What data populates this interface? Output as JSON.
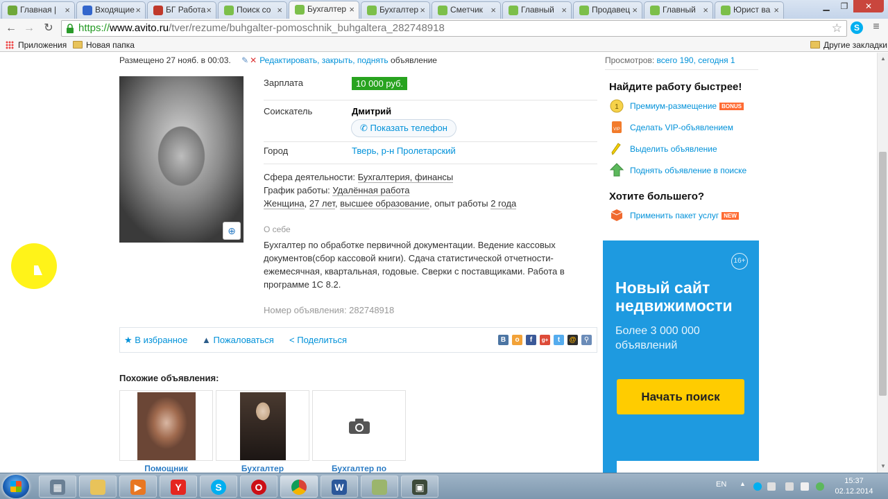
{
  "browser": {
    "tabs": [
      {
        "label": "Главная |",
        "color": "#6ea83a"
      },
      {
        "label": "Входящие",
        "color": "#3366cc"
      },
      {
        "label": "БГ Работа",
        "color": "#c0392b"
      },
      {
        "label": "Поиск со",
        "color": "#7cbf4a"
      },
      {
        "label": "Бухгалтер",
        "color": "#7cbf4a",
        "active": true
      },
      {
        "label": "Бухгалтер",
        "color": "#7cbf4a"
      },
      {
        "label": "Сметчик",
        "color": "#7cbf4a"
      },
      {
        "label": "Главный",
        "color": "#7cbf4a"
      },
      {
        "label": "Продавец",
        "color": "#7cbf4a"
      },
      {
        "label": "Главный",
        "color": "#7cbf4a"
      },
      {
        "label": "Юрист ва",
        "color": "#7cbf4a"
      }
    ],
    "url_scheme": "https://",
    "url_host": "www.avito.ru",
    "url_path": "/tver/rezume/buhgalter-pomoschnik_buhgaltera_282748918",
    "bookmarks": {
      "apps": "Приложения",
      "new_folder": "Новая папка",
      "other": "Другие закладки"
    }
  },
  "listing": {
    "posted": "Размещено 27 нояб. в 00:03.",
    "edit_link": "Редактировать, закрыть, поднять",
    "edit_suffix": "объявление",
    "salary_label": "Зарплата",
    "salary_value": "10 000 руб.",
    "applicant_label": "Соискатель",
    "applicant_name": "Дмитрий",
    "phone_button": "Показать телефон",
    "city_label": "Город",
    "city_value": "Тверь, р-н Пролетарский",
    "sphere_label": "Сфера деятельности:",
    "sphere_value": "Бухгалтерия, финансы",
    "schedule_label": "График работы:",
    "schedule_value": "Удалённая работа",
    "gender": "Женщина",
    "age": "27 лет",
    "education": "высшее образование",
    "experience_label": ", опыт работы",
    "experience_value": "2 года",
    "about_title": "О себе",
    "about_text": "Бухгалтер по обработке первичной документации. Ведение кассовых документов(сбор кассовой книги). Сдача статистической отчетности-ежемесячная, квартальная, годовые. Сверки с поставщиками. Работа в программе 1С 8.2.",
    "ad_number": "Номер объявления: 282748918"
  },
  "actions": {
    "favorite": "В избранное",
    "complain": "Пожаловаться",
    "share": "Поделиться",
    "social": [
      {
        "name": "vk",
        "glyph": "В",
        "color": "#4c75a3"
      },
      {
        "name": "odnoklassniki",
        "glyph": "о",
        "color": "#f2a238"
      },
      {
        "name": "facebook",
        "glyph": "f",
        "color": "#3b5998"
      },
      {
        "name": "google-plus",
        "glyph": "g+",
        "color": "#dd4b39"
      },
      {
        "name": "twitter",
        "glyph": "t",
        "color": "#55acee"
      },
      {
        "name": "mail-ru",
        "glyph": "@",
        "color": "#2d2d2d"
      },
      {
        "name": "link",
        "glyph": "⚲",
        "color": "#6b8cb8"
      }
    ]
  },
  "similar": {
    "title": "Похожие объявления:",
    "items": [
      {
        "title": "Помощник",
        "photo": "person-photo"
      },
      {
        "title": "Бухгалтер",
        "photo": "person-photo"
      },
      {
        "title": "Бухгалтер по",
        "photo": "camera-icon"
      }
    ]
  },
  "sidebar": {
    "views": "Просмотров:",
    "views_link": "всего 190, сегодня 1",
    "faster_title": "Найдите работу быстрее!",
    "items": [
      {
        "label": "Премиум-размещение",
        "badge": "BONUS",
        "icon": "premium-coin-icon"
      },
      {
        "label": "Сделать VIP-объявлением",
        "icon": "vip-icon"
      },
      {
        "label": "Выделить объявление",
        "icon": "highlighter-icon"
      },
      {
        "label": "Поднять объявление в поиске",
        "icon": "up-arrow-icon"
      }
    ],
    "more_title": "Хотите большего?",
    "package_label": "Применить пакет услуг",
    "package_badge": "NEW"
  },
  "banner": {
    "age": "16+",
    "title": "Новый сайт недвижимости",
    "subtitle": "Более 3 000 000 объявлений",
    "button": "Начать поиск"
  },
  "taskbar": {
    "lang": "EN",
    "time": "15:37",
    "date": "02.12.2014",
    "apps": [
      "calculator",
      "explorer",
      "media-player",
      "yandex-browser",
      "skype",
      "opera",
      "chrome",
      "word",
      "file-manager",
      "media"
    ]
  }
}
